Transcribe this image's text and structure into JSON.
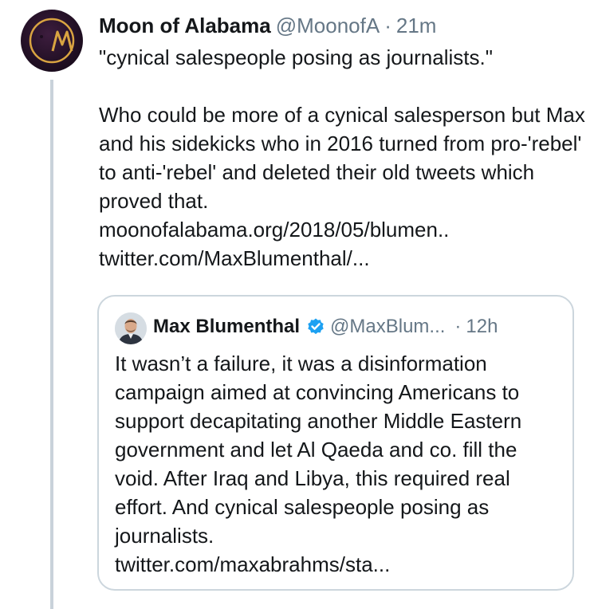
{
  "tweet": {
    "author": {
      "display_name": "Moon of Alabama",
      "handle": "@MoonofA",
      "avatar_icon": "moon-logo-icon"
    },
    "separator": "·",
    "time": "21m",
    "text_line_1": "\"cynical salespeople posing as journalists.\"",
    "text_body": "Who could be more of a cynical salesperson but Max and his sidekicks who in 2016 turned from pro-'rebel' to anti-'rebel' and deleted their old tweets which proved that.",
    "link_1": "moonofalabama.org/2018/05/blumen..",
    "link_2": "twitter.com/MaxBlumenthal/..."
  },
  "quoted_tweet": {
    "author": {
      "display_name": "Max Blumenthal",
      "handle": "@MaxBlum...",
      "verified_icon": "verified-badge-icon",
      "avatar_icon": "profile-photo-icon"
    },
    "separator": "·",
    "time": "12h",
    "text": "It wasn’t a failure, it was a disinformation campaign aimed at convincing Americans to support decapitating another Middle Eastern government and let Al Qaeda and co. fill the void. After Iraq and Libya, this required real effort. And cynical salespeople posing as journalists.",
    "link": "twitter.com/maxabrahms/sta..."
  },
  "colors": {
    "text": "#14171a",
    "muted": "#657786",
    "thread_line": "#c9d2da",
    "border": "#ccd6dd",
    "verified": "#1da1f2",
    "logo_gold": "#d9a441"
  }
}
